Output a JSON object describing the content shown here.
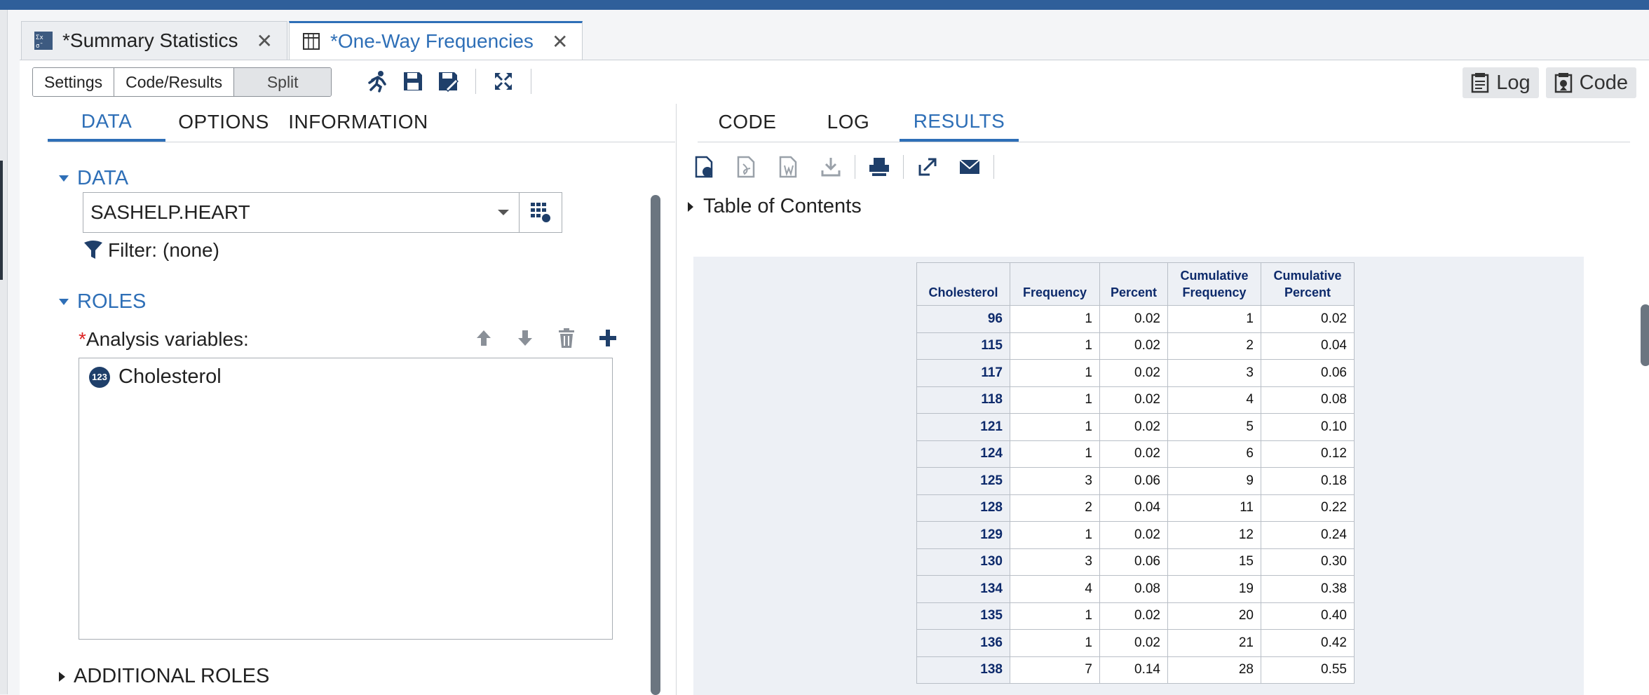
{
  "colors": {
    "accent": "#2e6fb7",
    "header_blue": "#2f5f9a",
    "table_header_text": "#0d2a6b",
    "required": "#dd2222"
  },
  "doc_tabs": [
    {
      "label": "*Summary Statistics",
      "icon": "summary-stats-icon",
      "close": "✕"
    },
    {
      "label": "*One-Way Frequencies",
      "icon": "table-grid-icon",
      "close": "✕"
    }
  ],
  "toolbar": {
    "view_buttons": [
      "Settings",
      "Code/Results",
      "Split"
    ],
    "icons": [
      "run-icon",
      "save-icon",
      "save-as-icon",
      "maximize-icon"
    ],
    "right": {
      "log_label": "Log",
      "code_label": "Code"
    }
  },
  "left_pane": {
    "tabs": [
      "DATA",
      "OPTIONS",
      "INFORMATION"
    ],
    "data_section": "DATA",
    "dataset": "SASHELP.HEART",
    "filter_label": "Filter:",
    "filter_value": "(none)",
    "roles_section": "ROLES",
    "analysis_required": "*",
    "analysis_label": "Analysis variables:",
    "role_icons": [
      "move-up-icon",
      "move-down-icon",
      "delete-icon",
      "add-icon"
    ],
    "variables": [
      {
        "badge": "123",
        "name": "Cholesterol"
      }
    ],
    "additional_roles": "ADDITIONAL ROLES"
  },
  "right_pane": {
    "tabs": [
      "CODE",
      "LOG",
      "RESULTS"
    ],
    "result_icons": [
      "html-output-icon",
      "pdf-output-icon",
      "word-output-icon",
      "download-icon",
      "print-icon",
      "expand-icon",
      "email-icon"
    ],
    "toc_label": "Table of Contents",
    "table": {
      "columns": [
        "Cholesterol",
        "Frequency",
        "Percent",
        "Cumulative Frequency",
        "Cumulative Percent"
      ],
      "rows": [
        [
          "96",
          "1",
          "0.02",
          "1",
          "0.02"
        ],
        [
          "115",
          "1",
          "0.02",
          "2",
          "0.04"
        ],
        [
          "117",
          "1",
          "0.02",
          "3",
          "0.06"
        ],
        [
          "118",
          "1",
          "0.02",
          "4",
          "0.08"
        ],
        [
          "121",
          "1",
          "0.02",
          "5",
          "0.10"
        ],
        [
          "124",
          "1",
          "0.02",
          "6",
          "0.12"
        ],
        [
          "125",
          "3",
          "0.06",
          "9",
          "0.18"
        ],
        [
          "128",
          "2",
          "0.04",
          "11",
          "0.22"
        ],
        [
          "129",
          "1",
          "0.02",
          "12",
          "0.24"
        ],
        [
          "130",
          "3",
          "0.06",
          "15",
          "0.30"
        ],
        [
          "134",
          "4",
          "0.08",
          "19",
          "0.38"
        ],
        [
          "135",
          "1",
          "0.02",
          "20",
          "0.40"
        ],
        [
          "136",
          "1",
          "0.02",
          "21",
          "0.42"
        ],
        [
          "138",
          "7",
          "0.14",
          "28",
          "0.55"
        ]
      ]
    }
  }
}
